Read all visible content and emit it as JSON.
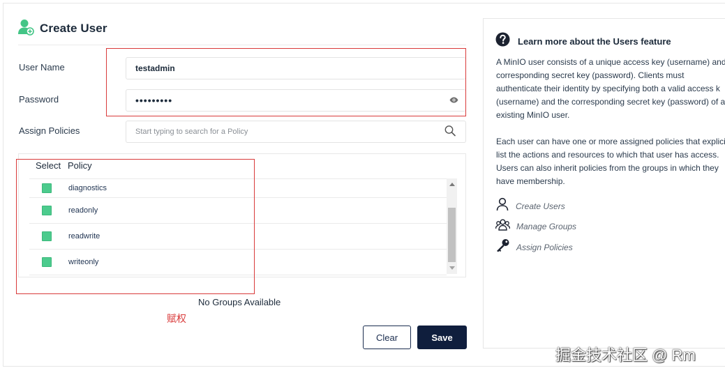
{
  "header": {
    "title": "Create User",
    "icon": "user-add-icon"
  },
  "form": {
    "username": {
      "label": "User Name",
      "value": "testadmin"
    },
    "password": {
      "label": "Password",
      "value": "•••••••••"
    },
    "policies": {
      "label": "Assign Policies",
      "placeholder": "Start typing to search for a Policy"
    }
  },
  "policy_table": {
    "columns": [
      "Select",
      "Policy"
    ],
    "rows": [
      {
        "name": "diagnostics",
        "checked": true
      },
      {
        "name": "readonly",
        "checked": true
      },
      {
        "name": "readwrite",
        "checked": true
      },
      {
        "name": "writeonly",
        "checked": true
      }
    ]
  },
  "groups": {
    "empty_text": "No Groups Available"
  },
  "annotation": {
    "text": "赋权",
    "color": "#d93a3a"
  },
  "buttons": {
    "clear": "Clear",
    "save": "Save"
  },
  "help": {
    "title": "Learn more about the Users feature",
    "paragraph1": "A MinIO user consists of a unique access key (username) and\ncorresponding secret key (password). Clients must\nauthenticate their identity by specifying both a valid access k\n(username) and the corresponding secret key (password) of a\nexisting MinIO user.",
    "paragraph2": "Each user can have one or more assigned policies that explici\nlist the actions and resources to which that user has access.\nUsers can also inherit policies from the groups in which they\nhave membership.",
    "links": [
      {
        "label": "Create Users",
        "icon": "user-icon"
      },
      {
        "label": "Manage Groups",
        "icon": "users-group-icon"
      },
      {
        "label": "Assign Policies",
        "icon": "key-icon"
      }
    ]
  },
  "watermark": "掘金技术社区 @ Rm",
  "colors": {
    "accent": "#4ccb8d",
    "primary": "#0f1e3d",
    "annotation": "#d93a3a"
  }
}
